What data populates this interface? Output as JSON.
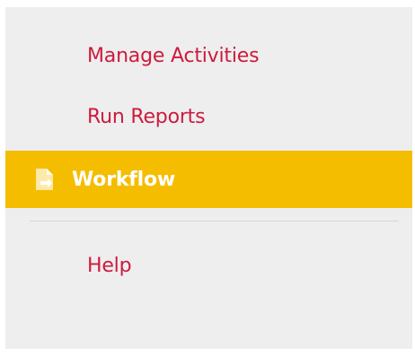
{
  "menu": {
    "items": [
      {
        "label": "Manage Activities",
        "active": false
      },
      {
        "label": "Run Reports",
        "active": false
      },
      {
        "label": "Workflow",
        "active": true,
        "icon": "document-arrow-icon"
      },
      {
        "label": "Help",
        "active": false
      }
    ]
  },
  "colors": {
    "panel_background": "#eeeeee",
    "link_text": "#cc1b3d",
    "active_background": "#f5bd00",
    "active_text": "#ffffff",
    "divider": "#d6d6d6"
  }
}
